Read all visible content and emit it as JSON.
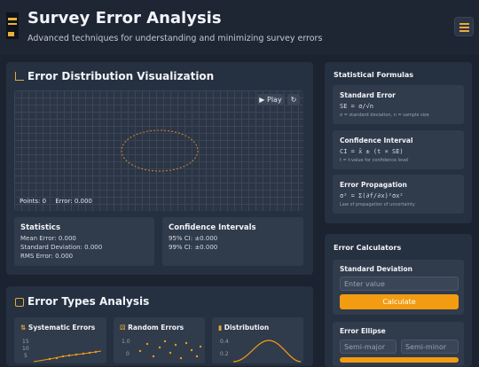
{
  "header": {
    "title": "Survey Error Analysis",
    "subtitle": "Advanced techniques for understanding and minimizing survey errors",
    "menu_icon": "sliders-icon"
  },
  "visualization": {
    "title": "Error Distribution Visualization",
    "play_label": "Play",
    "points_label": "Points: 0",
    "error_label": "Error: 0.000",
    "statistics": {
      "title": "Statistics",
      "mean": "Mean Error: 0.000",
      "std": "Standard Deviation: 0.000",
      "rms": "RMS Error: 0.000"
    },
    "confidence": {
      "title": "Confidence Intervals",
      "ci95": "95% CI: ±0.000",
      "ci99": "99% CI: ±0.000"
    }
  },
  "error_types": {
    "title": "Error Types Analysis",
    "systematic": "Systematic Errors",
    "random": "Random Errors",
    "distribution": "Distribution",
    "systematic_ticks": [
      "15",
      "10",
      "5",
      "0"
    ],
    "random_ticks": [
      "1.0",
      "0",
      "-1.0"
    ],
    "distribution_ticks": [
      "0.4",
      "0.2"
    ]
  },
  "formulas": {
    "title": "Statistical Formulas",
    "items": [
      {
        "name": "Standard Error",
        "formula": "SE = σ/√n",
        "note": "σ = standard deviation, n = sample size"
      },
      {
        "name": "Confidence Interval",
        "formula": "CI = x̄ ± (t × SE)",
        "note": "t = t-value for confidence level"
      },
      {
        "name": "Error Propagation",
        "formula": "σ² = Σ(∂f/∂x)²σx²",
        "note": "Law of propagation of uncertainty"
      }
    ]
  },
  "calculators": {
    "title": "Error Calculators",
    "std_title": "Standard Deviation",
    "std_placeholder": "Enter value",
    "calculate_label": "Calculate",
    "ellipse_title": "Error Ellipse",
    "semi_major_placeholder": "Semi-major",
    "semi_minor_placeholder": "Semi-minor"
  },
  "colors": {
    "accent": "#f39c12",
    "background": "#1b2230",
    "panel": "#253041"
  }
}
